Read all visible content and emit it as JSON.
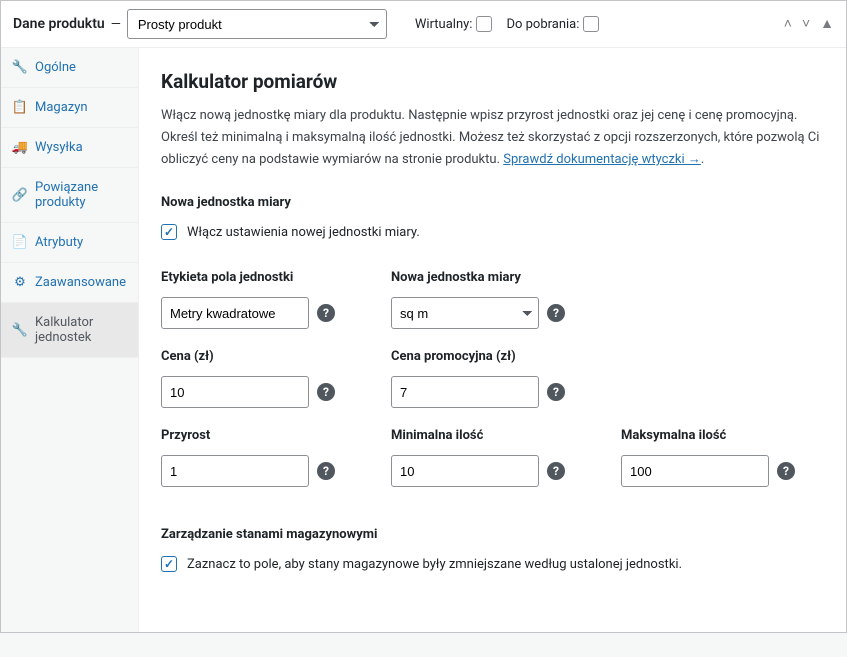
{
  "header": {
    "title": "Dane produktu",
    "dash": "—",
    "product_type": "Prosty produkt",
    "virtual_label": "Wirtualny:",
    "downloadable_label": "Do pobrania:"
  },
  "sidebar": {
    "items": [
      {
        "label": "Ogólne",
        "icon": "🔧"
      },
      {
        "label": "Magazyn",
        "icon": "📋"
      },
      {
        "label": "Wysyłka",
        "icon": "🚚"
      },
      {
        "label": "Powiązane produkty",
        "icon": "🔗"
      },
      {
        "label": "Atrybuty",
        "icon": "📄"
      },
      {
        "label": "Zaawansowane",
        "icon": "⚙"
      },
      {
        "label": "Kalkulator jednostek",
        "icon": "🔧"
      }
    ]
  },
  "main": {
    "heading": "Kalkulator pomiarów",
    "description_pre": "Włącz nową jednostkę miary dla produktu. Następnie wpisz przyrost jednostki oraz jej cenę i cenę promocyjną. Określ też minimalną i maksymalną ilość jednostki. Możesz też skorzystać z opcji rozszerzonych, które pozwolą Ci obliczyć ceny na podstawie wymiarów na stronie produktu. ",
    "doc_link_text": "Sprawdź dokumentację wtyczki →",
    "doc_link_period": ".",
    "new_unit_section_title": "Nowa jednostka miary",
    "enable_unit_checkbox_label": "Włącz ustawienia nowej jednostki miary.",
    "fields": {
      "unit_field_label": {
        "label": "Etykieta pola jednostki",
        "value": "Metry kwadratowe"
      },
      "new_unit": {
        "label": "Nowa jednostka miary",
        "value": "sq m"
      },
      "price": {
        "label": "Cena (zł)",
        "value": "10"
      },
      "sale_price": {
        "label": "Cena promocyjna (zł)",
        "value": "7"
      },
      "increment": {
        "label": "Przyrost",
        "value": "1"
      },
      "min_qty": {
        "label": "Minimalna ilość",
        "value": "10"
      },
      "max_qty": {
        "label": "Maksymalna ilość",
        "value": "100"
      }
    },
    "stock_section_title": "Zarządzanie stanami magazynowymi",
    "stock_checkbox_label": "Zaznacz to pole, aby stany magazynowe były zmniejszane według ustalonej jednostki.",
    "help_glyph": "?"
  }
}
